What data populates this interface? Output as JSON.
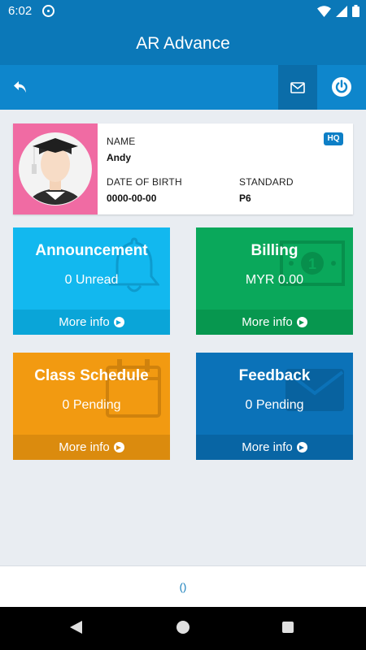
{
  "status_bar": {
    "time": "6:02"
  },
  "header": {
    "title": "AR Advance"
  },
  "toolbar": {
    "back_icon": "reply-icon",
    "mail_icon": "envelope-icon",
    "power_icon": "power-icon"
  },
  "profile": {
    "name_label": "NAME",
    "name_value": "Andy",
    "badge": "HQ",
    "dob_label": "DATE OF BIRTH",
    "dob_value": "0000-00-00",
    "standard_label": "STANDARD",
    "standard_value": "P6"
  },
  "tiles": [
    {
      "title": "Announcement",
      "subtitle": "0 Unread",
      "link": "More info",
      "icon": "bell-icon",
      "color": "#12b8ef"
    },
    {
      "title": "Billing",
      "subtitle": "MYR 0.00",
      "link": "More info",
      "icon": "money-icon",
      "color": "#0aa85b"
    },
    {
      "title": "Class Schedule",
      "subtitle": "0 Pending",
      "link": "More info",
      "icon": "calendar-icon",
      "color": "#f29a11"
    },
    {
      "title": "Feedback",
      "subtitle": "0 Pending",
      "link": "More info",
      "icon": "envelope-icon",
      "color": "#0b72b8"
    }
  ],
  "footer": {
    "text": "()"
  }
}
